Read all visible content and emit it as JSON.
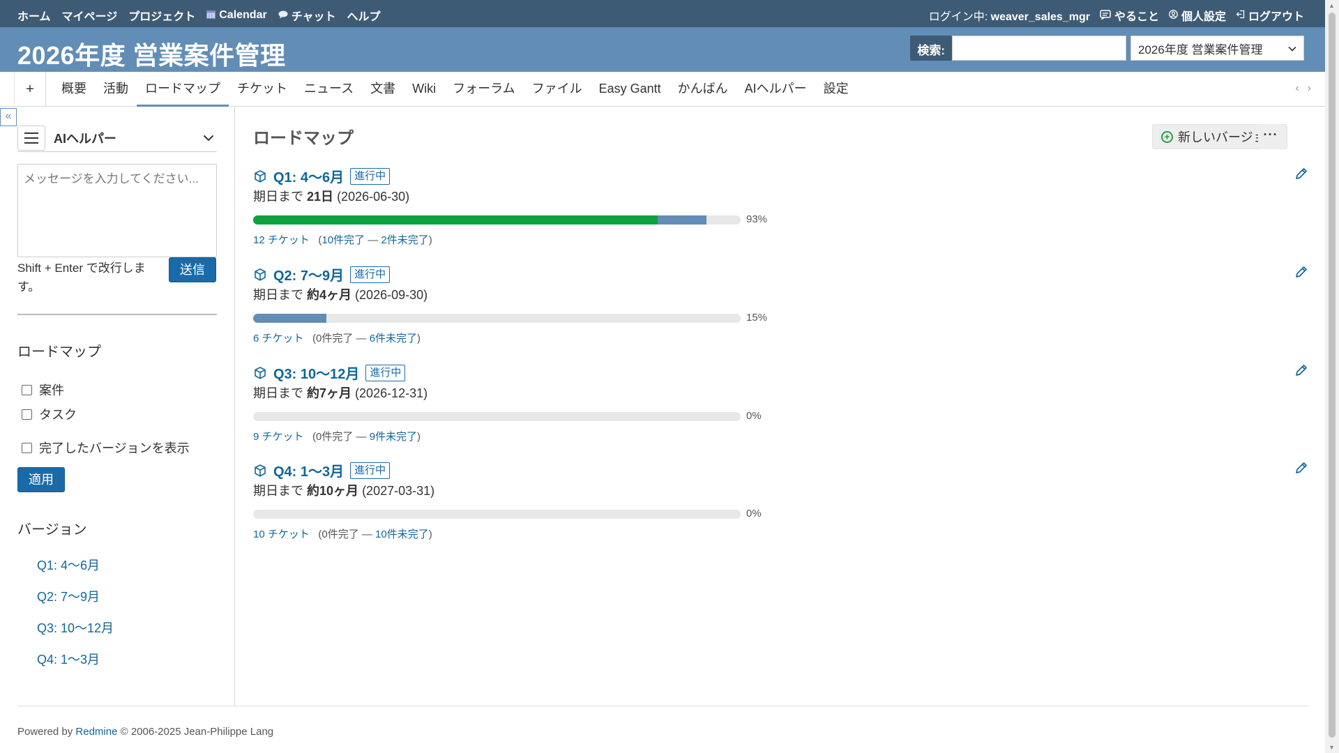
{
  "top_menu": {
    "left_items": [
      {
        "label": "ホーム"
      },
      {
        "label": "マイページ"
      },
      {
        "label": "プロジェクト"
      },
      {
        "label": "Calendar"
      },
      {
        "label": "チャット"
      },
      {
        "label": "ヘルプ"
      }
    ],
    "login_prefix": "ログイン中:",
    "login_user": "weaver_sales_mgr",
    "todo": "やること",
    "my_account": "個人設定",
    "logout": "ログアウト"
  },
  "header": {
    "title": "2026年度 営業案件管理",
    "search_label": "検索:",
    "search_value": "",
    "project_jump": "2026年度 営業案件管理"
  },
  "main_menu": {
    "new_object": "+",
    "tabs": [
      {
        "label": "概要"
      },
      {
        "label": "活動"
      },
      {
        "label": "ロードマップ"
      },
      {
        "label": "チケット"
      },
      {
        "label": "ニュース"
      },
      {
        "label": "文書"
      },
      {
        "label": "Wiki"
      },
      {
        "label": "フォーラム"
      },
      {
        "label": "ファイル"
      },
      {
        "label": "Easy Gantt"
      },
      {
        "label": "かんばん"
      },
      {
        "label": "AIヘルパー"
      },
      {
        "label": "設定"
      }
    ],
    "selected_tab": "ロードマップ"
  },
  "sidebar": {
    "toggle": "«",
    "ai_helper": {
      "title": "AIヘルパー",
      "placeholder": "メッセージを入力してください...",
      "hint": "Shift + Enter で改行します。",
      "send_label": "送信"
    },
    "roadmap_heading": "ロードマップ",
    "filters": [
      {
        "label": "案件",
        "checked": false
      },
      {
        "label": "タスク",
        "checked": false
      }
    ],
    "show_completed": {
      "label": "完了したバージョンを表示",
      "checked": false
    },
    "apply_label": "適用",
    "versions_heading": "バージョン",
    "versions": [
      {
        "label": "Q1: 4〜6月"
      },
      {
        "label": "Q2: 7〜9月"
      },
      {
        "label": "Q3: 10〜12月"
      },
      {
        "label": "Q4: 1〜3月"
      }
    ]
  },
  "content": {
    "title": "ロードマップ",
    "new_version_label": "新しいバージョン",
    "more_label": "···",
    "versions": [
      {
        "name": "Q1: 4〜6月",
        "status": "進行中",
        "due_prefix": "期日まで",
        "due_value": "21日",
        "due_date": "(2026-06-30)",
        "closed_pct": 83,
        "done_pct": 93,
        "pct_label": "93%",
        "tickets_label": "12 チケット",
        "closed_label": "10件完了",
        "separator": "—",
        "open_label": "2件未完了"
      },
      {
        "name": "Q2: 7〜9月",
        "status": "進行中",
        "due_prefix": "期日まで",
        "due_value": "約4ヶ月",
        "due_date": "(2026-09-30)",
        "closed_pct": 0,
        "done_pct": 15,
        "pct_label": "15%",
        "tickets_label": "6 チケット",
        "closed_label": "0件完了",
        "separator": "—",
        "open_label": "6件未完了"
      },
      {
        "name": "Q3: 10〜12月",
        "status": "進行中",
        "due_prefix": "期日まで",
        "due_value": "約7ヶ月",
        "due_date": "(2026-12-31)",
        "closed_pct": 0,
        "done_pct": 0,
        "pct_label": "0%",
        "tickets_label": "9 チケット",
        "closed_label": "0件完了",
        "separator": "—",
        "open_label": "9件未完了"
      },
      {
        "name": "Q4: 1〜3月",
        "status": "進行中",
        "due_prefix": "期日まで",
        "due_value": "約10ヶ月",
        "due_date": "(2027-03-31)",
        "closed_pct": 0,
        "done_pct": 0,
        "pct_label": "0%",
        "tickets_label": "10 チケット",
        "closed_label": "0件完了",
        "separator": "—",
        "open_label": "10件未完了"
      }
    ]
  },
  "footer": {
    "powered_by": "Powered by",
    "redmine": "Redmine",
    "copyright": "© 2006-2025 Jean-Philippe Lang"
  },
  "colors": {
    "top_menu_bg": "#3e5b76",
    "header_bg": "#628db6",
    "link": "#1166aa",
    "progress_closed": "#0da23f",
    "progress_done": "#628db6",
    "button_primary": "#1b6aa8"
  }
}
